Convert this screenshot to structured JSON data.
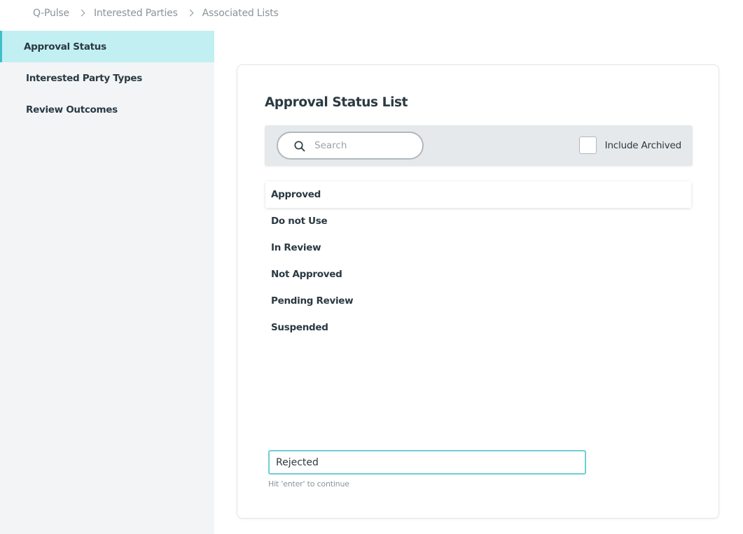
{
  "breadcrumb": [
    "Q-Pulse",
    "Interested Parties",
    "Associated Lists"
  ],
  "sidebar": {
    "items": [
      {
        "label": "Approval Status",
        "active": true
      },
      {
        "label": "Interested Party Types",
        "active": false
      },
      {
        "label": "Review Outcomes",
        "active": false
      }
    ]
  },
  "main": {
    "title": "Approval Status List",
    "search": {
      "placeholder": "Search",
      "value": ""
    },
    "include_archived": {
      "label": "Include Archived",
      "checked": false
    },
    "items": [
      "Approved",
      "Do not Use",
      "In Review",
      "Not Approved",
      "Pending Review",
      "Suspended"
    ],
    "selected_item": "Approved",
    "new_item": {
      "value": "Rejected",
      "hint": "Hit 'enter' to continue"
    }
  },
  "colors": {
    "accent": "#3dbfc8",
    "active_bg": "#c2eff2",
    "sidebar_bg": "#f3f4f6",
    "toolbar_bg": "#e6e9eb"
  }
}
